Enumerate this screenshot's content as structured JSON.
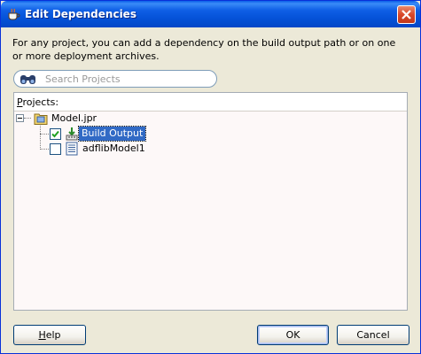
{
  "window": {
    "title": "Edit Dependencies"
  },
  "description": "For any project, you can add a dependency on the build output path or on one or more deployment archives.",
  "search": {
    "placeholder": "Search Projects"
  },
  "panel": {
    "label_mnemonic": "P",
    "label_rest": "rojects:"
  },
  "tree": {
    "root": {
      "label": "Model.jpr",
      "expanded": true
    },
    "children": [
      {
        "label": "Build Output",
        "checked": true,
        "selected": true
      },
      {
        "label": "adflibModel1",
        "checked": false,
        "selected": false
      }
    ]
  },
  "buttons": {
    "help_mnemonic": "H",
    "help_rest": "elp",
    "ok": "OK",
    "cancel": "Cancel"
  },
  "colors": {
    "titlebar": "#0552d8",
    "selection": "#316ac5",
    "dialog_bg": "#ece9d8"
  }
}
